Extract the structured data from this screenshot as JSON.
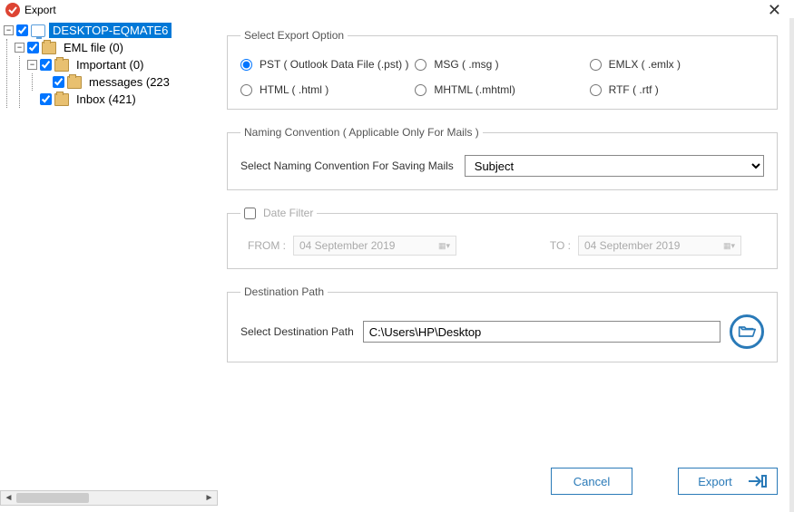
{
  "window": {
    "title": "Export"
  },
  "tree": {
    "root": {
      "label": "DESKTOP-EQMATE6"
    },
    "n1": {
      "label": "EML file (0)"
    },
    "n2": {
      "label": "Important (0)"
    },
    "n3": {
      "label": "messages (223"
    },
    "n4": {
      "label": "Inbox (421)"
    }
  },
  "exportOptions": {
    "legend": "Select Export Option",
    "pst": "PST ( Outlook Data File (.pst) )",
    "msg": "MSG  ( .msg )",
    "emlx": "EMLX  ( .emlx )",
    "html": "HTML  ( .html )",
    "mhtml": "MHTML  (.mhtml)",
    "rtf": "RTF  ( .rtf )",
    "selected": "pst"
  },
  "naming": {
    "legend": "Naming Convention ( Applicable Only For Mails )",
    "label": "Select Naming Convention For Saving Mails",
    "value": "Subject"
  },
  "dateFilter": {
    "legend": "Date Filter",
    "fromLabel": "FROM :",
    "toLabel": "TO :",
    "fromValue": "04 September 2019",
    "toValue": "04 September 2019",
    "enabled": false
  },
  "dest": {
    "legend": "Destination Path",
    "label": "Select Destination Path",
    "value": "C:\\Users\\HP\\Desktop"
  },
  "buttons": {
    "cancel": "Cancel",
    "export": "Export"
  }
}
